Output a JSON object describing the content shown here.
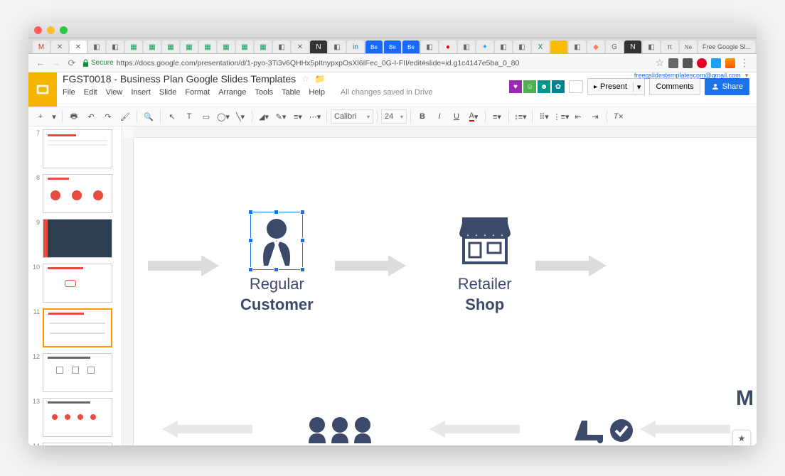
{
  "browser": {
    "last_tab": "Free Google Sl...",
    "secure_label": "Secure",
    "url": "https://docs.google.com/presentation/d/1-pyo-3Ti3v6QHHx5pItnypxpOsXl6IFec_0G-I-FII/edit#slide=id.g1c4147e5ba_0_80"
  },
  "doc": {
    "title": "FGST0018 - Business Plan Google Slides Templates",
    "user_email": "freegslidestemplatescom@gmail.com",
    "save_status": "All changes saved in Drive"
  },
  "menus": {
    "file": "File",
    "edit": "Edit",
    "view": "View",
    "insert": "Insert",
    "slide": "Slide",
    "format": "Format",
    "arrange": "Arrange",
    "tools": "Tools",
    "table": "Table",
    "help": "Help"
  },
  "buttons": {
    "present": "Present",
    "comments": "Comments",
    "share": "Share"
  },
  "toolbar": {
    "font": "Calibri",
    "font_size": "24"
  },
  "thumbs": [
    7,
    8,
    9,
    10,
    11,
    12,
    13,
    14
  ],
  "active_thumb_index": 4,
  "slide": {
    "item1_line1": "Regular",
    "item1_line2": "Customer",
    "item2_line1": "Retailer",
    "item2_line2": "Shop",
    "big_letter": "M"
  }
}
